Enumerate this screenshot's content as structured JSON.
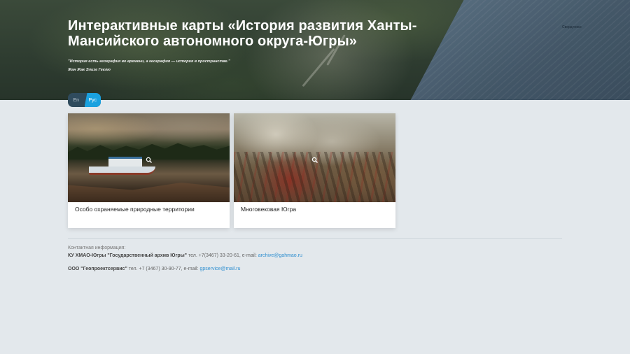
{
  "header": {
    "title": "Интерактивные карты «История развития Ханты-Мансийского автономного округа-Югры»",
    "quote": "\"История есть география во времени, а география — история в пространстве.\"",
    "author": "Жан Жак Элизе Геклю",
    "map_label": "Свердловск"
  },
  "language_switch": {
    "options": [
      {
        "label": "En",
        "active": false
      },
      {
        "label": "Рус",
        "active": true
      }
    ]
  },
  "cards": [
    {
      "title": "Особо охраняемые природные территории",
      "icon": "magnifier-icon"
    },
    {
      "title": "Многовековая Югра",
      "icon": "magnifier-icon"
    }
  ],
  "footer": {
    "contact_label": "Контактная информация:",
    "contacts": [
      {
        "org": "КУ ХМАО-Югры \"Государственный архив Югры\"",
        "details": " тел. +7(3467) 33-20-61, e-mail: ",
        "email": "archive@gahmao.ru"
      },
      {
        "org": "ООО \"Геопроектсервис\"",
        "details": " тел. +7 (3467) 30-90-77, e-mail: ",
        "email": "gpservice@mail.ru"
      }
    ]
  },
  "colors": {
    "accent": "#1aa1df",
    "link": "#2f8fd0",
    "page_background": "#e3e8ec"
  }
}
